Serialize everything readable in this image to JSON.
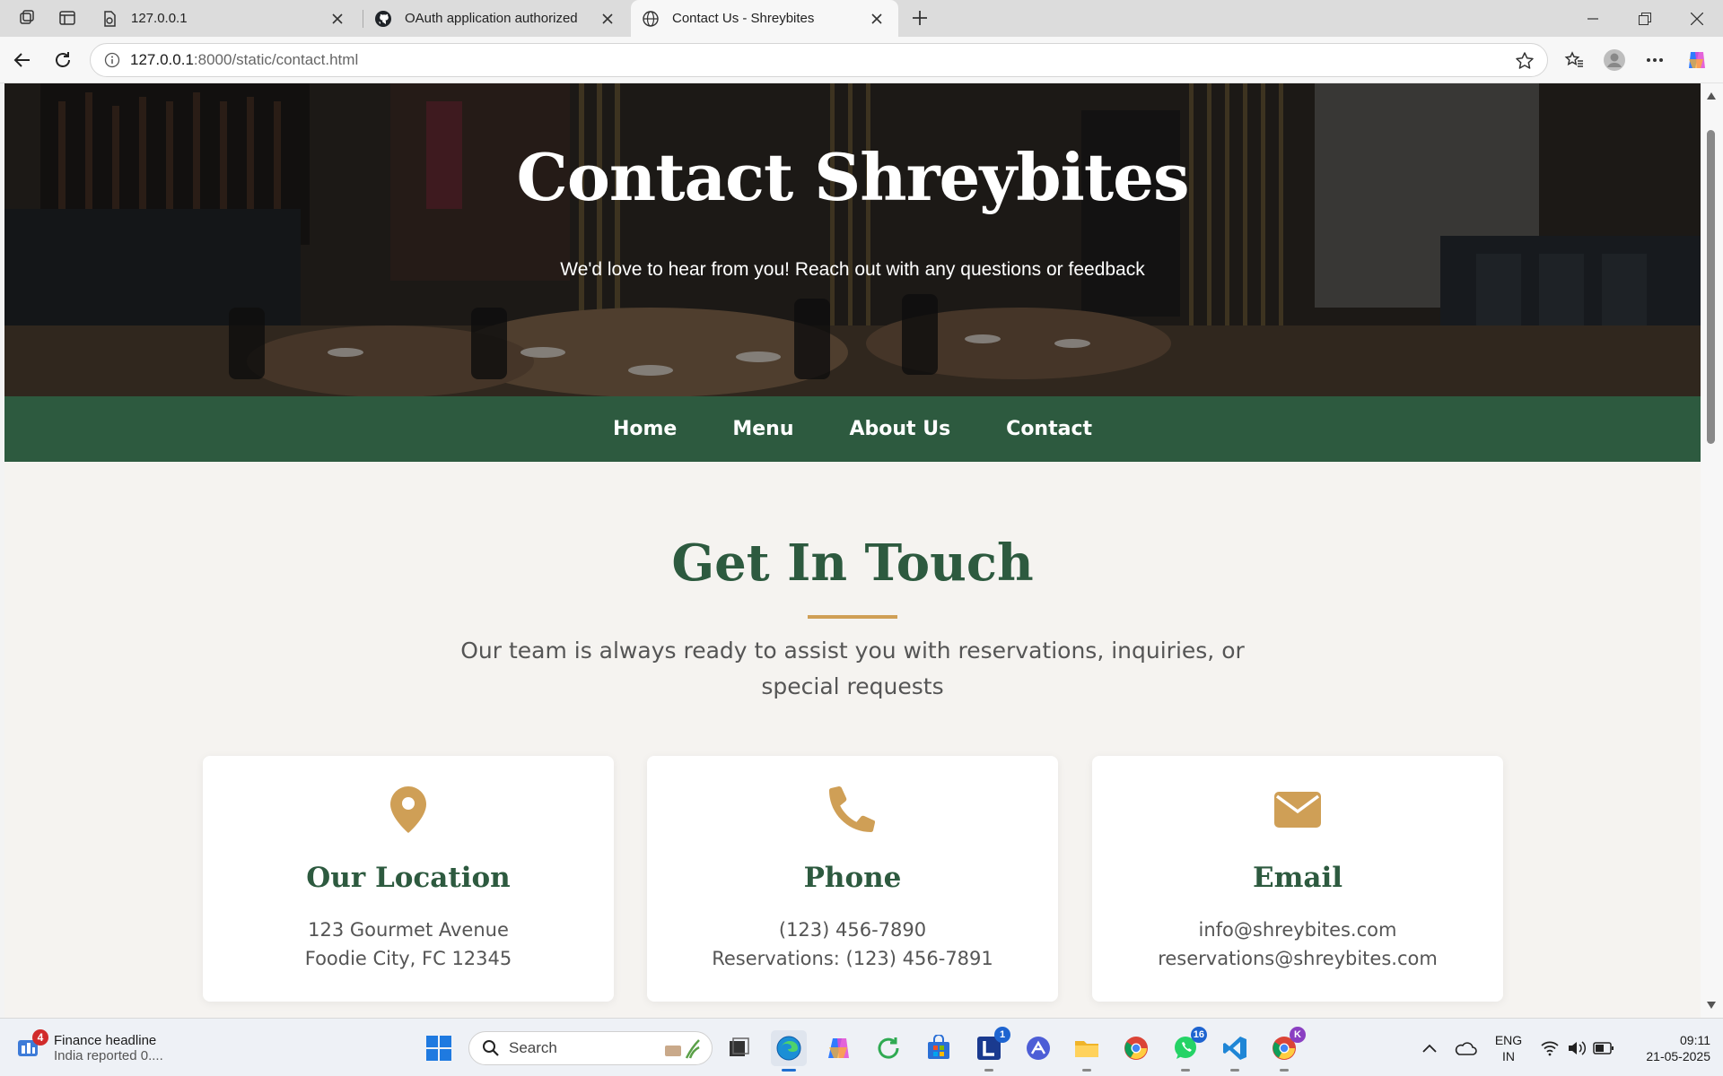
{
  "browser": {
    "tabs": [
      {
        "label": "127.0.0.1",
        "icon": "document-icon",
        "active": false
      },
      {
        "label": "OAuth application authorized",
        "icon": "github-icon",
        "active": false
      },
      {
        "label": "Contact Us - Shreybites",
        "icon": "globe-icon",
        "active": true
      }
    ],
    "url_host": "127.0.0.1",
    "url_path": ":8000/static/contact.html"
  },
  "page": {
    "hero": {
      "title": "Contact Shreybites",
      "subtitle": "We'd love to hear from you! Reach out with any questions or feedback"
    },
    "nav": [
      "Home",
      "Menu",
      "About Us",
      "Contact"
    ],
    "section": {
      "title": "Get In Touch",
      "desc_line1": "Our team is always ready to assist you with reservations, inquiries, or",
      "desc_line2": "special requests"
    },
    "cards": [
      {
        "title": "Our Location",
        "icon": "location-pin-icon",
        "line1": "123 Gourmet Avenue",
        "line2": "Foodie City, FC 12345"
      },
      {
        "title": "Phone",
        "icon": "phone-icon",
        "line1": "(123) 456-7890",
        "line2": "Reservations: (123) 456-7891"
      },
      {
        "title": "Email",
        "icon": "envelope-icon",
        "line1": "info@shreybites.com",
        "line2": "reservations@shreybites.com"
      }
    ]
  },
  "taskbar": {
    "news_badge": "4",
    "news_title": "Finance headline",
    "news_sub": "India reported 0....",
    "search_placeholder": "Search",
    "badge_l": "1",
    "badge_whatsapp": "16",
    "badge_chrome_profile": "K",
    "lang1": "ENG",
    "lang2": "IN",
    "time": "09:11",
    "date": "21-05-2025"
  },
  "colors": {
    "brand_green": "#2d5a3f",
    "accent_gold": "#cf9f56"
  }
}
